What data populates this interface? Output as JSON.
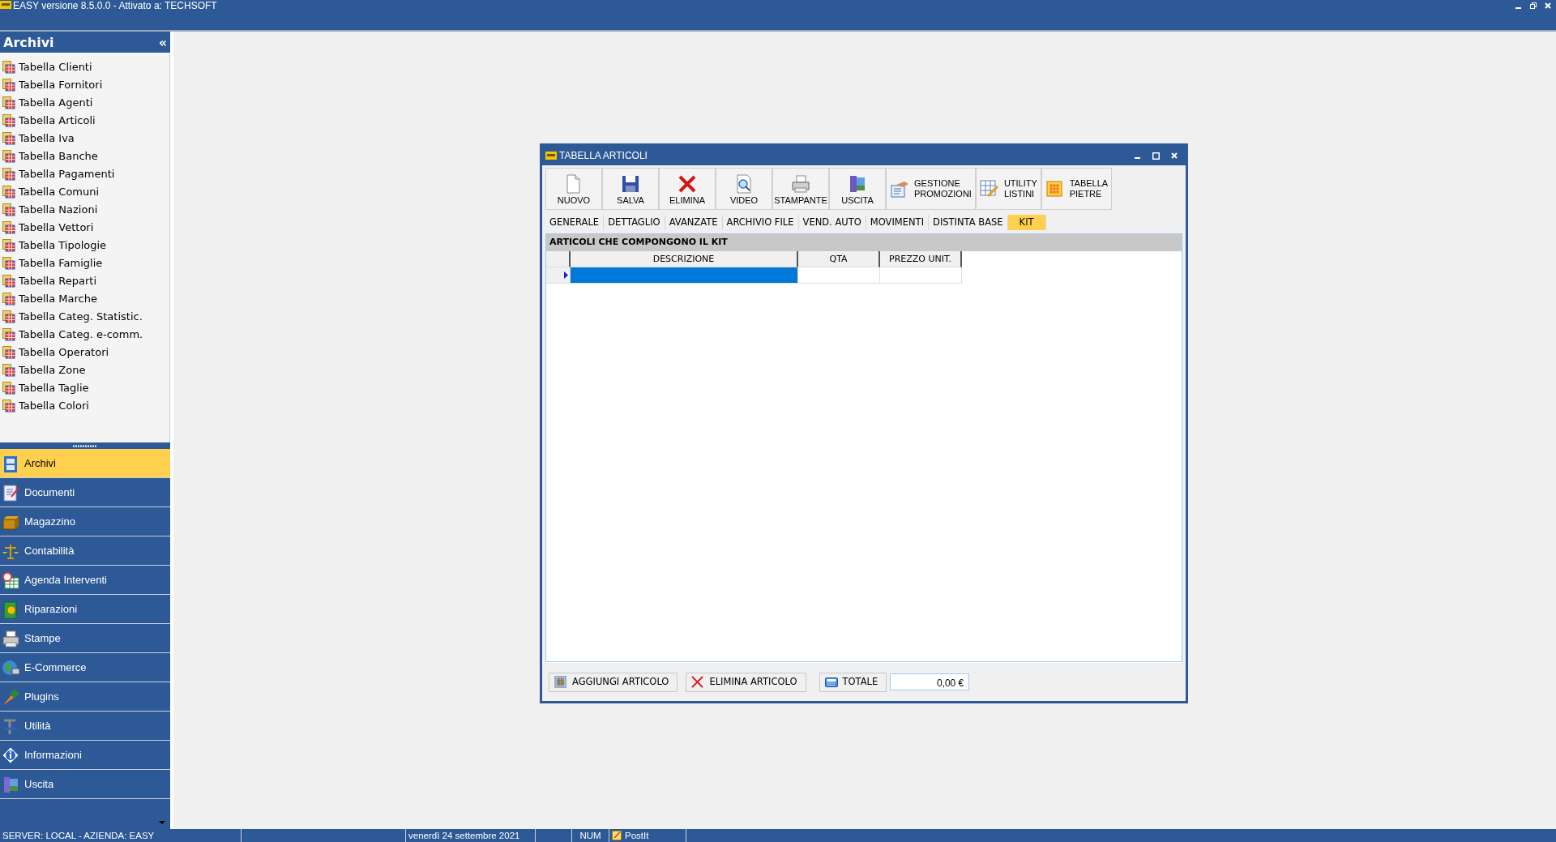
{
  "app_title": "EASY versione 8.5.0.0 - Attivato a: TECHSOFT",
  "sidebar": {
    "title": "Archivi",
    "collapse_glyph": "«",
    "items": [
      {
        "label": "Tabella Clienti"
      },
      {
        "label": "Tabella Fornitori"
      },
      {
        "label": "Tabella Agenti"
      },
      {
        "label": "Tabella Articoli"
      },
      {
        "label": "Tabella Iva"
      },
      {
        "label": "Tabella Banche"
      },
      {
        "label": "Tabella Pagamenti"
      },
      {
        "label": "Tabella Comuni"
      },
      {
        "label": "Tabella Nazioni"
      },
      {
        "label": "Tabella Vettori"
      },
      {
        "label": "Tabella Tipologie"
      },
      {
        "label": "Tabella Famiglie"
      },
      {
        "label": "Tabella Reparti"
      },
      {
        "label": "Tabella Marche"
      },
      {
        "label": "Tabella Categ. Statistic."
      },
      {
        "label": "Tabella Categ. e-comm."
      },
      {
        "label": "Tabella Operatori"
      },
      {
        "label": "Tabella Zone"
      },
      {
        "label": "Tabella Taglie"
      },
      {
        "label": "Tabella Colori"
      }
    ]
  },
  "nav": [
    {
      "label": "Archivi",
      "selected": true
    },
    {
      "label": "Documenti",
      "selected": false
    },
    {
      "label": "Magazzino",
      "selected": false
    },
    {
      "label": "Contabilità",
      "selected": false
    },
    {
      "label": "Agenda Interventi",
      "selected": false
    },
    {
      "label": "Riparazioni",
      "selected": false
    },
    {
      "label": "Stampe",
      "selected": false
    },
    {
      "label": "E-Commerce",
      "selected": false
    },
    {
      "label": "Plugins",
      "selected": false
    },
    {
      "label": "Utilità",
      "selected": false
    },
    {
      "label": "Informazioni",
      "selected": false
    },
    {
      "label": "Uscita",
      "selected": false
    }
  ],
  "dialog": {
    "title": "TABELLA ARTICOLI",
    "toolbar": [
      {
        "label": "NUOVO",
        "kind": "big"
      },
      {
        "label": "SALVA",
        "kind": "big"
      },
      {
        "label": "ELIMINA",
        "kind": "big"
      },
      {
        "label": "VIDEO",
        "kind": "big"
      },
      {
        "label": "STAMPANTE",
        "kind": "big"
      },
      {
        "label": "USCITA",
        "kind": "big"
      },
      {
        "label": "GESTIONE PROMOZIONI",
        "kind": "wide"
      },
      {
        "label": "UTILITY LISTINI",
        "kind": "wide"
      },
      {
        "label": "TABELLA PIETRE",
        "kind": "wide"
      }
    ],
    "tabs": [
      {
        "label": "GENERALE",
        "selected": false
      },
      {
        "label": "DETTAGLIO",
        "selected": false
      },
      {
        "label": "AVANZATE",
        "selected": false
      },
      {
        "label": "ARCHIVIO FILE",
        "selected": false
      },
      {
        "label": "VEND. AUTO",
        "selected": false
      },
      {
        "label": "MOVIMENTI",
        "selected": false
      },
      {
        "label": "DISTINTA BASE",
        "selected": false
      },
      {
        "label": "KIT",
        "selected": true
      }
    ],
    "section_title": "ARTICOLI CHE COMPONGONO IL KIT",
    "grid": {
      "columns": [
        "DESCRIZIONE",
        "QTA",
        "PREZZO UNIT."
      ],
      "rows": [
        {
          "selected": true
        }
      ]
    },
    "footer": {
      "buttons": [
        "AGGIUNGI ARTICOLO",
        "ELIMINA ARTICOLO",
        "TOTALE"
      ],
      "total": "0,00 €"
    }
  },
  "status_bar": {
    "server": "SERVER: LOCAL - AZIENDA: EASY",
    "date": "venerdì 24 settembre 2021",
    "num": "NUM",
    "postit": "PostIt"
  }
}
